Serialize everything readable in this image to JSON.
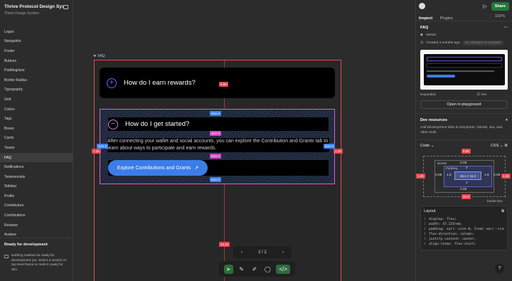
{
  "sidebar": {
    "title": "Thrive Protocol Design Syst...",
    "subtitle": "Thrive Design System",
    "items": [
      "Logos",
      "Navigation",
      "Footer",
      "Buttons",
      "Padding/size",
      "Border Radius",
      "Typography",
      "Grid",
      "Colors",
      "Tags",
      "Boxes",
      "Cards",
      "Toasts",
      "FAQ",
      "Notifications",
      "Testemonials",
      "Sidebar",
      "Profile",
      "Contributors",
      "Contributions",
      "Reviews",
      "Avatars"
    ],
    "active_item": "FAQ",
    "footer_title": "Ready for development",
    "footer_text": "Nothing marked as ready for development yet. Select a section or top level frame to mark it ready for dev."
  },
  "canvas": {
    "frame_label": "FAQ",
    "q1": "How do I earn rewards?",
    "q2": "How do I get started?",
    "answer": "After connecting your wallet and social accounts, you can explore the Contribution and Grants tab to learn about ways to participate and earn rewards.",
    "cta": "Explore Contributions and Grants",
    "tags": {
      "gap_top": "9.56",
      "size_top": "size-4",
      "size_mid1": "size-4",
      "size_mid2": "size-4",
      "size_bottom": "size-4",
      "size_left": "size-4",
      "size_right": "size-4",
      "left_val": "1.25",
      "right_val": "1.25",
      "bottom_val": "24.31"
    },
    "pager": "2 / 2"
  },
  "right_panel": {
    "share": "Share",
    "zoom": "102%",
    "tabs": [
      "Inspect",
      "Plugins"
    ],
    "component_name": "FAQ",
    "variant_label": "Variant",
    "created": "Created 4 months ago",
    "compare": "No changes to compare",
    "expanded_label": "Expanded",
    "expanded_value": "Yes",
    "playground": "Open in playground",
    "dev_resources_title": "Dev resources",
    "dev_resources_desc": "Add development links to Storybook, GitHub, Jira, and other tools.",
    "code_label": "Code",
    "css_label": "CSS",
    "box": {
      "margin_top": "9.56",
      "margin_bottom": "24.3",
      "margin_left": "1.25",
      "margin_right": "1.25",
      "border_label": "Border",
      "border_top": "0.06",
      "border_bottom": "0.06",
      "border_left": "0.06",
      "border_right": "0.06",
      "padding_label": "Padding",
      "padding_top": "2",
      "padding_bottom": "2",
      "padding_left": "1.5",
      "padding_right": "1.5",
      "content": "44.1 × 11.3",
      "box_sizing": "border-box"
    },
    "layout_title": "Layout",
    "code_lines": [
      "display: flex;",
      "width: 47.125rem;",
      "padding: var(--size-8, 2rem) var(--size",
      "flex-direction: column;",
      "justify-content: center;",
      "align-items: flex-start;"
    ]
  }
}
